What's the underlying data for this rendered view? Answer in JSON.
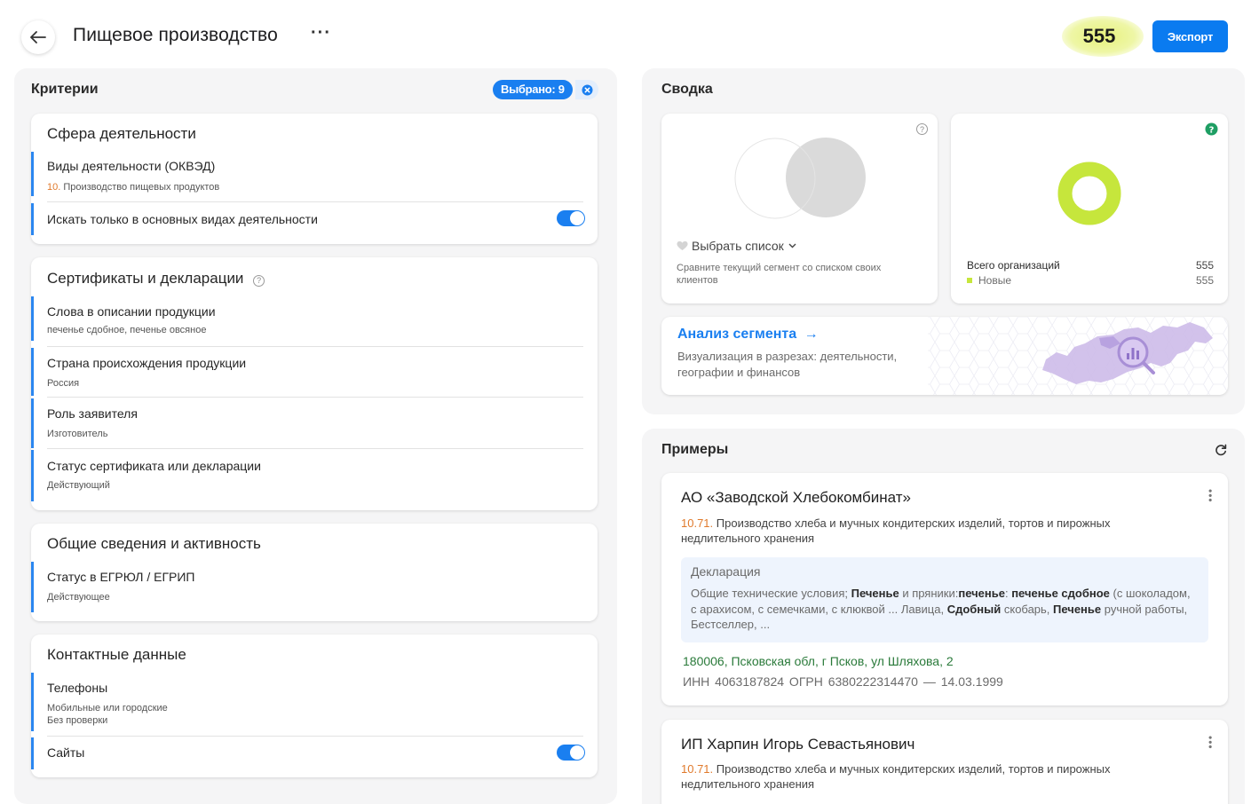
{
  "header": {
    "title": "Пищевое производство",
    "more_label": "···",
    "count": "555",
    "export_label": "Экспорт"
  },
  "criteria": {
    "title": "Критерии",
    "selected_label": "Выбрано: 9",
    "sections": {
      "activity": {
        "title": "Сфера деятельности",
        "okved_label": "Виды деятельности (ОКВЭД)",
        "okved_code": "10.",
        "okved_value": " Производство пищевых продуктов",
        "main_only_label": "Искать только в основных видах деятельности",
        "main_only_on": true
      },
      "certificates": {
        "title": "Сертификаты и декларации",
        "help_glyph": "?",
        "words_label": "Слова в описании продукции",
        "words_value": "печенье сдобное, печенье овсяное",
        "country_label": "Страна происхождения продукции",
        "country_value": "Россия",
        "role_label": "Роль заявителя",
        "role_value": "Изготовитель",
        "status_label": "Статус сертификата или декларации",
        "status_value": "Действующий"
      },
      "general": {
        "title": "Общие сведения и активность",
        "egrul_label": "Статус в ЕГРЮЛ / ЕГРИП",
        "egrul_value": "Действующее"
      },
      "contacts": {
        "title": "Контактные данные",
        "phones_label": "Телефоны",
        "phones_value_1": "Мобильные или городские",
        "phones_value_2": "Без проверки",
        "sites_label": "Сайты",
        "sites_on": true
      }
    }
  },
  "summary": {
    "title": "Сводка",
    "compare": {
      "help_glyph": "?",
      "select_list_label": "Выбрать список",
      "description": "Сравните текущий сегмент со списком своих клиентов"
    },
    "totals": {
      "help_glyph": "?",
      "total_label": "Всего организаций",
      "total_value": "555",
      "new_label": "Новые",
      "new_value": "555",
      "new_share": 1.0,
      "accent_color": "#c6e63c"
    },
    "analysis": {
      "title": "Анализ сегмента",
      "arrow": "→",
      "description": "Визуализация в разрезах: деятельности, географии и финансов"
    }
  },
  "examples": {
    "title": "Примеры",
    "items": [
      {
        "name": "АО «Заводской Хлебокомбинат»",
        "okved_code": "10.71.",
        "okved_text": " Производство хлеба и мучных кондитерских изделий, тортов и пирожных недлительного хранения",
        "decl_title": "Декларация",
        "decl_parts": [
          {
            "t": "Общие технические условия; ",
            "b": false
          },
          {
            "t": "Печенье",
            "b": true
          },
          {
            "t": " и пряники:",
            "b": false
          },
          {
            "t": "печенье",
            "b": true
          },
          {
            "t": ": ",
            "b": false
          },
          {
            "t": "печенье сдобное",
            "b": true
          },
          {
            "t": " (с шоколадом, с арахисом, с семечками, с клюквой ... Лавица, ",
            "b": false
          },
          {
            "t": "Сдобный",
            "b": true
          },
          {
            "t": " скобарь, ",
            "b": false
          },
          {
            "t": "Печенье",
            "b": true
          },
          {
            "t": " ручной работы, Бестселлер, ...",
            "b": false
          }
        ],
        "address": "180006, Псковская обл, г Псков, ул Шляхова, 2",
        "inn": "ИНН 4063187824   ОГРН 6380222314470 — 14.03.1999"
      },
      {
        "name": "ИП Харпин Игорь Севастьянович",
        "okved_code": "10.71.",
        "okved_text": " Производство хлеба и мучных кондитерских изделий, тортов и пирожных недлительного хранения"
      }
    ]
  }
}
